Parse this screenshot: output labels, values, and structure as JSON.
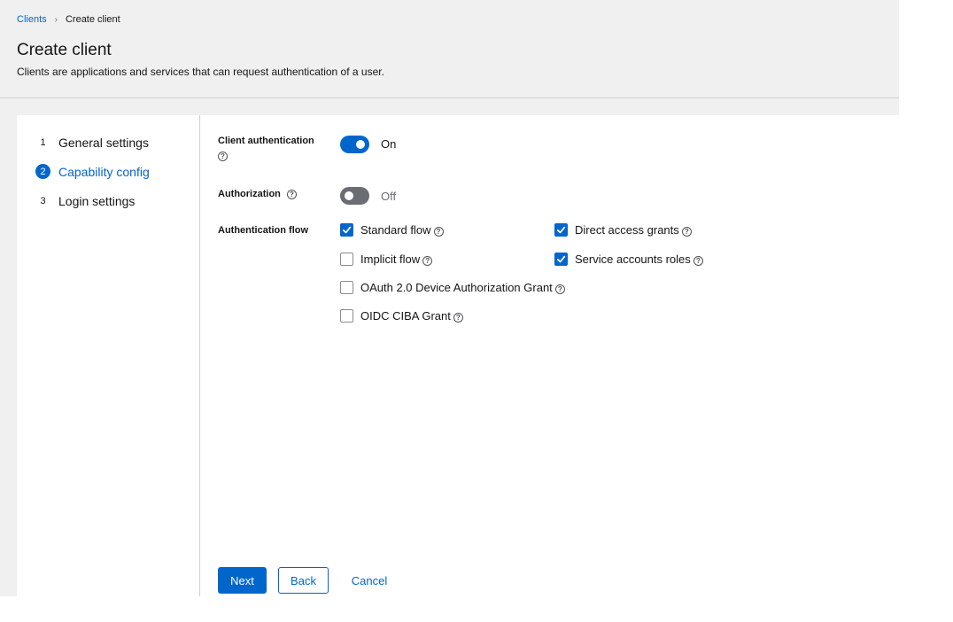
{
  "breadcrumb": {
    "parent": "Clients",
    "current": "Create client"
  },
  "header": {
    "title": "Create client",
    "description": "Clients are applications and services that can request authentication of a user."
  },
  "wizard": {
    "steps": [
      {
        "number": "1",
        "label": "General settings",
        "active": false
      },
      {
        "number": "2",
        "label": "Capability config",
        "active": true
      },
      {
        "number": "3",
        "label": "Login settings",
        "active": false
      }
    ]
  },
  "form": {
    "client_authentication": {
      "label": "Client authentication",
      "state": "On",
      "enabled": true
    },
    "authorization": {
      "label": "Authorization",
      "state": "Off",
      "enabled": false
    },
    "authentication_flow": {
      "label": "Authentication flow",
      "options": [
        {
          "label": "Standard flow",
          "checked": true
        },
        {
          "label": "Direct access grants",
          "checked": true
        },
        {
          "label": "Implicit flow",
          "checked": false
        },
        {
          "label": "Service accounts roles",
          "checked": true
        },
        {
          "label": "OAuth 2.0 Device Authorization Grant",
          "checked": false
        },
        {
          "label": "OIDC CIBA Grant",
          "checked": false
        }
      ]
    }
  },
  "footer": {
    "next_label": "Next",
    "back_label": "Back",
    "cancel_label": "Cancel"
  },
  "icons": {
    "help": "help-icon",
    "check": "check-icon",
    "separator": "chevron-right-icon"
  },
  "colors": {
    "accent": "#0066cc",
    "toggle_off": "#6a6e73",
    "page_bg": "#f0f0f0"
  }
}
